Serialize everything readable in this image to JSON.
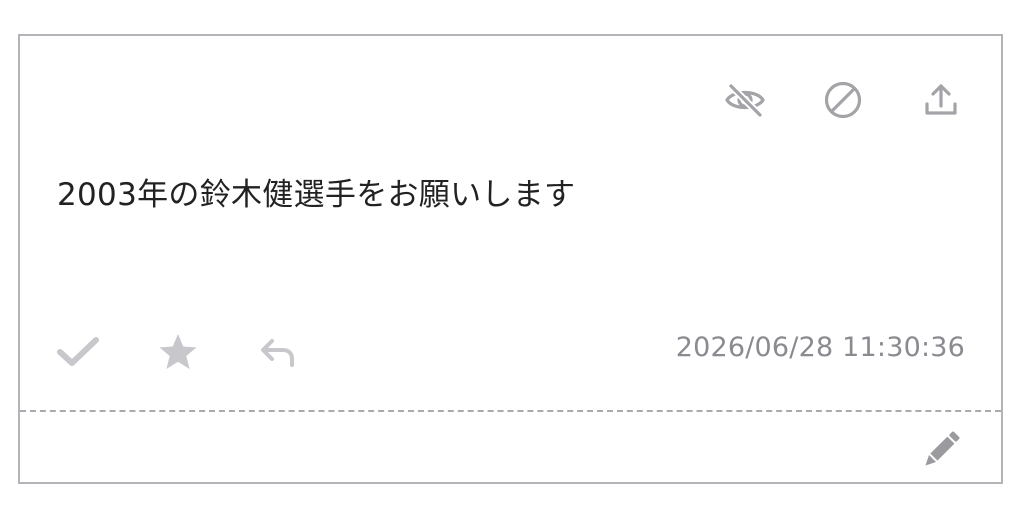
{
  "message": {
    "text": "2003年の鈴木健選手をお願いします",
    "timestamp": "2026/06/28 11:30:36"
  },
  "icons": {
    "hide": "eye-slash-icon",
    "block": "ban-icon",
    "share": "upload-icon",
    "check": "check-icon",
    "star": "star-icon",
    "reply": "reply-icon",
    "edit": "pencil-icon"
  },
  "colors": {
    "top_icon": "#a3a3a8",
    "bottom_icon": "#c8c8cc",
    "edit_icon": "#9a9a9f",
    "text": "#222222",
    "timestamp": "#8a8a90",
    "border": "#b3b3b8"
  }
}
